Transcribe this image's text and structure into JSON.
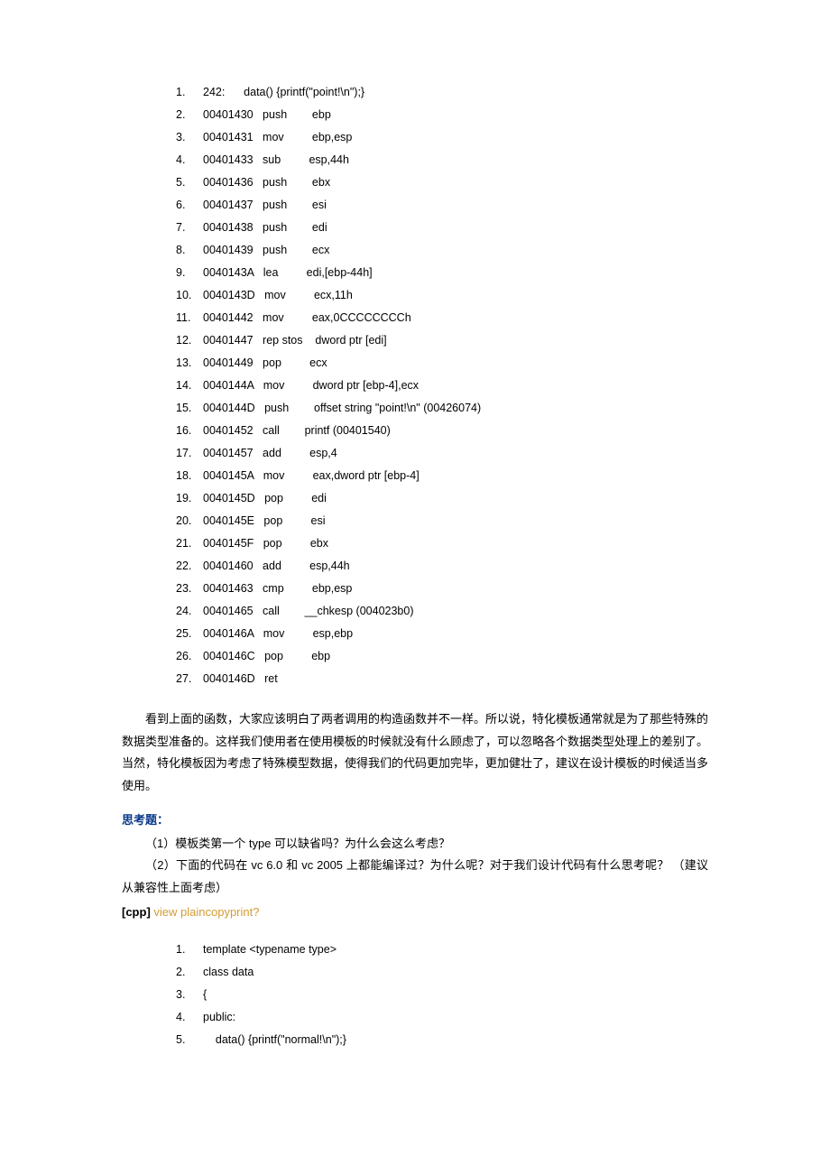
{
  "asm": [
    "242:      data() {printf(\"point!\\n\");}",
    "00401430   push        ebp",
    "00401431   mov         ebp,esp",
    "00401433   sub         esp,44h",
    "00401436   push        ebx",
    "00401437   push        esi",
    "00401438   push        edi",
    "00401439   push        ecx",
    "0040143A   lea         edi,[ebp-44h]",
    "0040143D   mov         ecx,11h",
    "00401442   mov         eax,0CCCCCCCCh",
    "00401447   rep stos    dword ptr [edi]",
    "00401449   pop         ecx",
    "0040144A   mov         dword ptr [ebp-4],ecx",
    "0040144D   push        offset string \"point!\\n\" (00426074)",
    "00401452   call        printf (00401540)",
    "00401457   add         esp,4",
    "0040145A   mov         eax,dword ptr [ebp-4]",
    "0040145D   pop         edi",
    "0040145E   pop         esi",
    "0040145F   pop         ebx",
    "00401460   add         esp,44h",
    "00401463   cmp         ebp,esp",
    "00401465   call        __chkesp (004023b0)",
    "0040146A   mov         esp,ebp",
    "0040146C   pop         ebp",
    "0040146D   ret"
  ],
  "para1": "看到上面的函数，大家应该明白了两者调用的构造函数并不一样。所以说，特化模板通常就是为了那些特殊的数据类型准备的。这样我们使用者在使用模板的时候就没有什么顾虑了，可以忽略各个数据类型处理上的差别了。当然，特化模板因为考虑了特殊模型数据，使得我们的代码更加完毕，更加健壮了，建议在设计模板的时候适当多使用。",
  "think_title": "思考题：",
  "q1": "（1）模板类第一个 type 可以缺省吗？为什么会这么考虑？",
  "q2": "（2）下面的代码在 vc 6.0 和 vc 2005 上都能编译过？为什么呢？对于我们设计代码有什么思考呢？  （建议从兼容性上面考虑）",
  "cpp_label": "[cpp] ",
  "links": {
    "view": "view plain",
    "copy": "copy",
    "print": "print",
    "help": "?"
  },
  "code2": [
    "template <typename type>",
    "class data",
    "{",
    "public:",
    "    data() {printf(\"normal!\\n\");}"
  ]
}
